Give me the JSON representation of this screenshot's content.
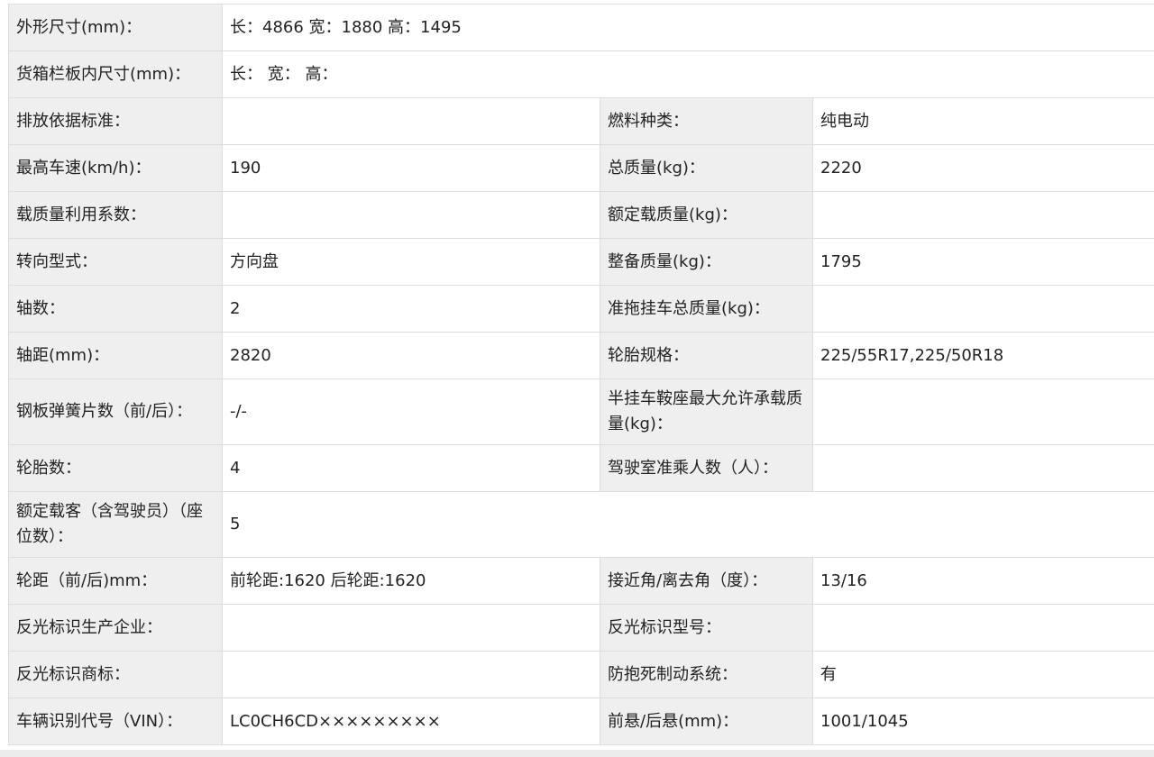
{
  "rows": [
    {
      "l1": "外形尺寸(mm)：",
      "v1": "长：4866 宽：1880 高：1495"
    },
    {
      "l1": "货箱栏板内尺寸(mm)：",
      "v1": "长：  宽：  高："
    },
    {
      "l1": "排放依据标准：",
      "v1": "",
      "l2": "燃料种类：",
      "v2": "纯电动"
    },
    {
      "l1": "最高车速(km/h)：",
      "v1": "190",
      "l2": "总质量(kg)：",
      "v2": "2220"
    },
    {
      "l1": "载质量利用系数：",
      "v1": "",
      "l2": "额定载质量(kg)：",
      "v2": ""
    },
    {
      "l1": "转向型式：",
      "v1": "方向盘",
      "l2": "整备质量(kg)：",
      "v2": "1795"
    },
    {
      "l1": "轴数：",
      "v1": "2",
      "l2": "准拖挂车总质量(kg)：",
      "v2": ""
    },
    {
      "l1": "轴距(mm)：",
      "v1": "2820",
      "l2": "轮胎规格：",
      "v2": "225/55R17,225/50R18"
    },
    {
      "l1": "钢板弹簧片数（前/后）：",
      "v1": "-/-",
      "l2": "半挂车鞍座最大允许承载质量(kg)：",
      "v2": ""
    },
    {
      "l1": "轮胎数：",
      "v1": "4",
      "l2": "驾驶室准乘人数（人）：",
      "v2": ""
    },
    {
      "l1": "额定载客（含驾驶员）（座位数）：",
      "v1": "5"
    },
    {
      "l1": "轮距（前/后)mm：",
      "v1": "前轮距:1620 后轮距:1620",
      "l2": "接近角/离去角（度）：",
      "v2": "13/16"
    },
    {
      "l1": "反光标识生产企业：",
      "v1": "",
      "l2": "反光标识型号：",
      "v2": ""
    },
    {
      "l1": "反光标识商标：",
      "v1": "",
      "l2": "防抱死制动系统：",
      "v2": "有"
    },
    {
      "l1": "车辆识别代号（VIN）：",
      "v1": "LC0CH6CD×××××××××",
      "l2": "前悬/后悬(mm)：",
      "v2": "1001/1045"
    }
  ]
}
